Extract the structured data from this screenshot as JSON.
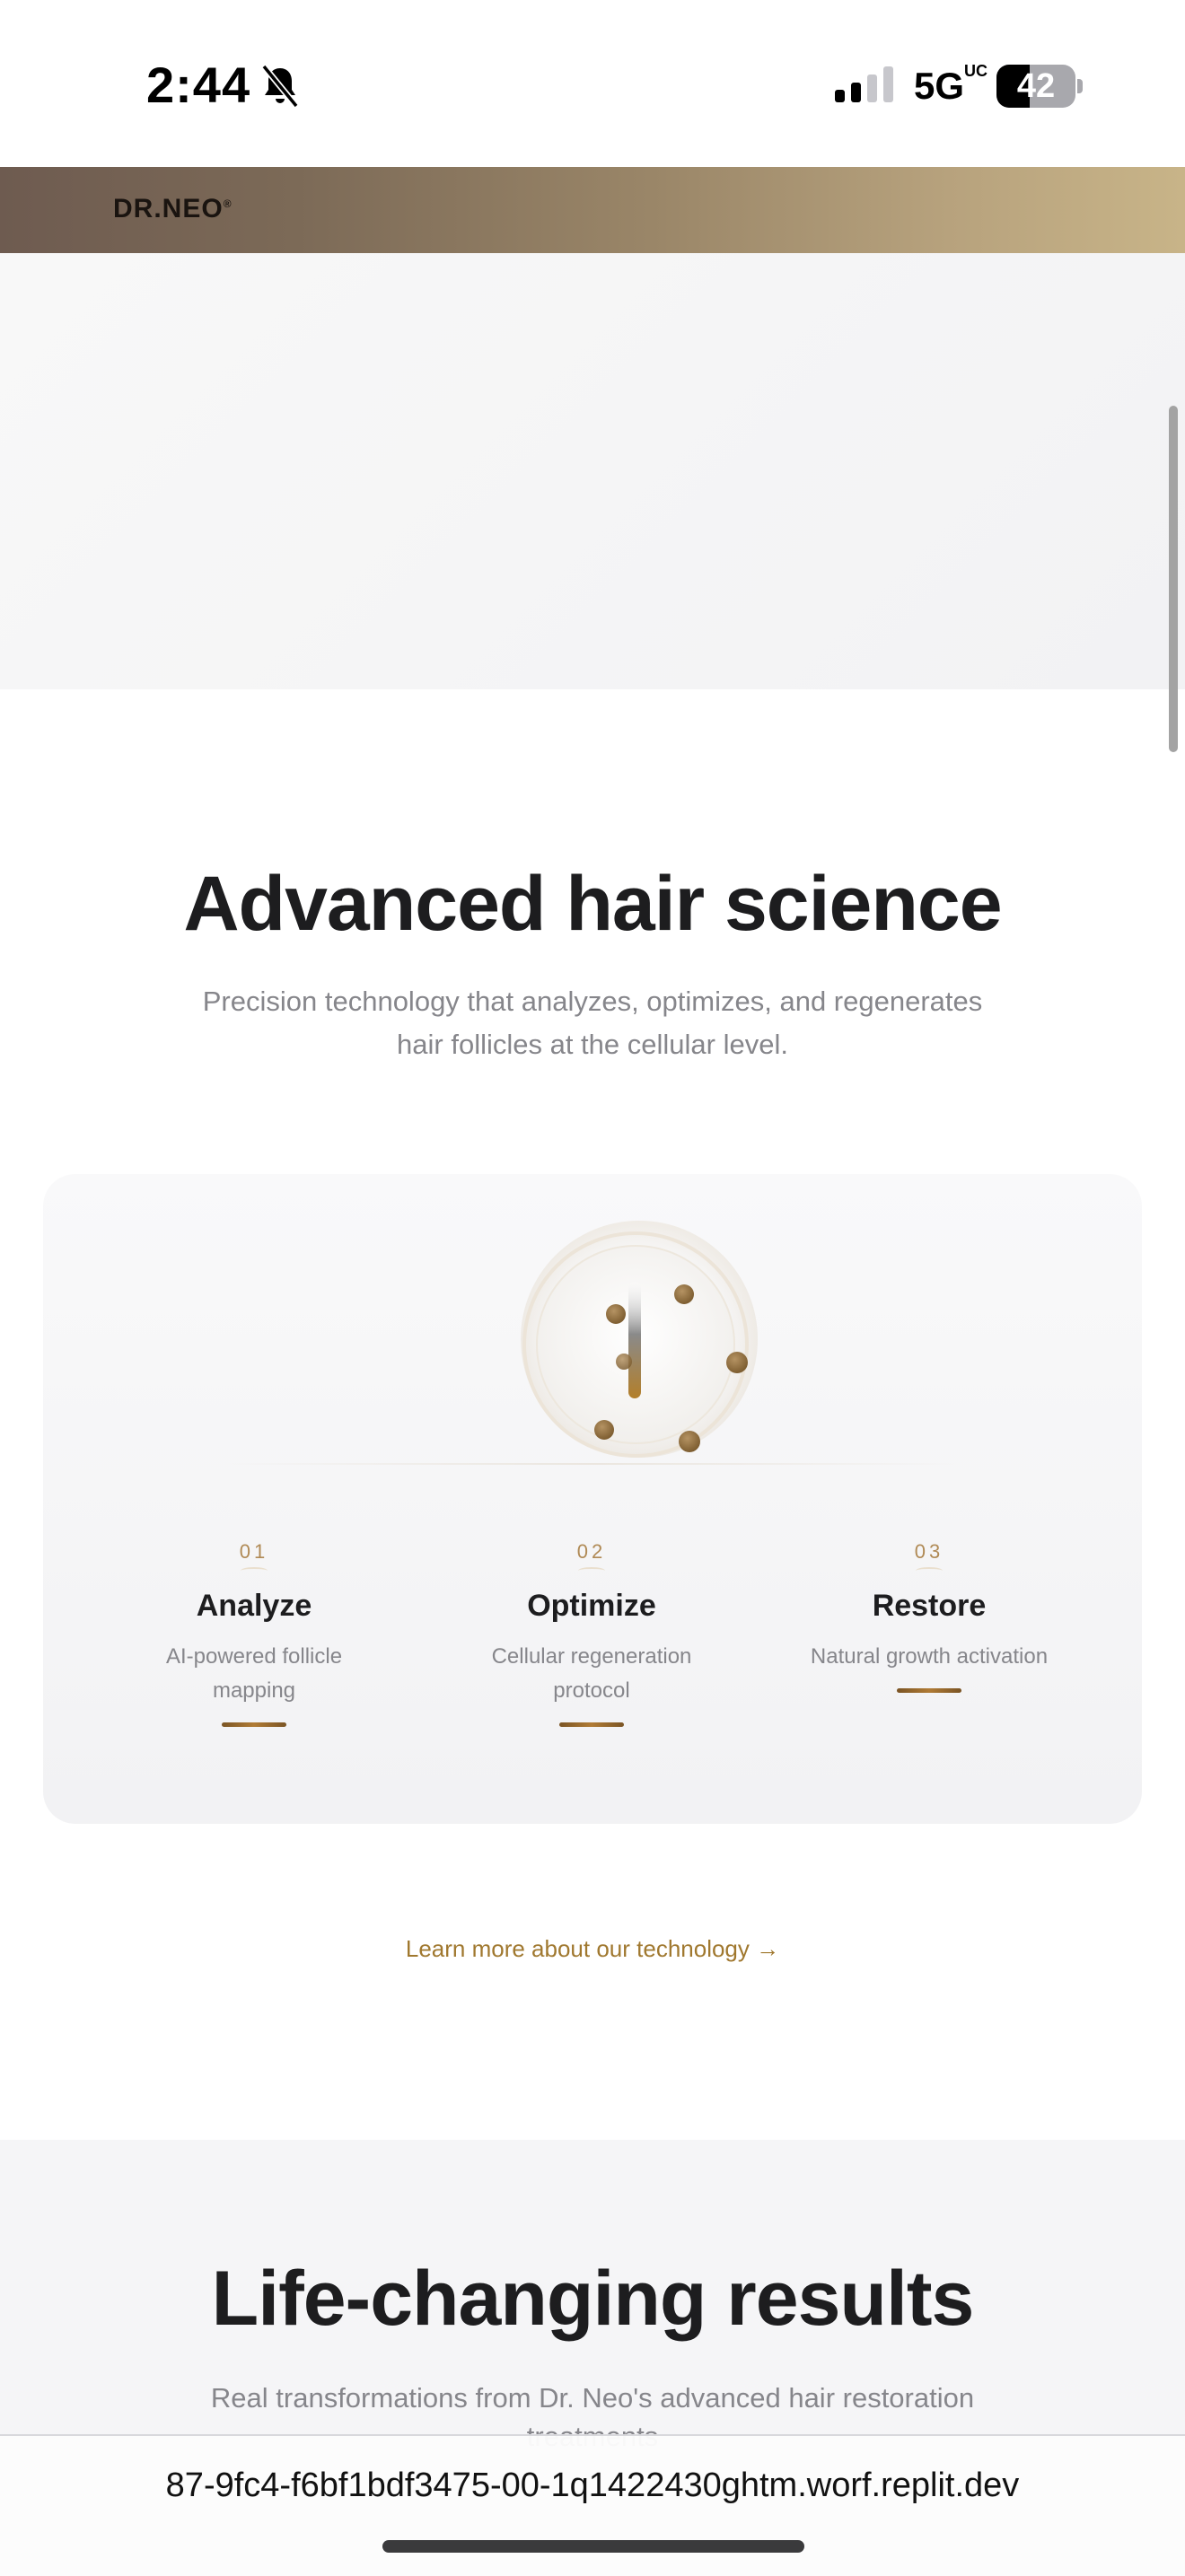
{
  "status_bar": {
    "time": "2:44",
    "network": "5G",
    "network_suffix": "UC",
    "battery": "42",
    "battery_level": 0.42,
    "icons": [
      "bell-slash-icon",
      "signal-icon",
      "battery-icon"
    ]
  },
  "brand": {
    "logo": "DR.NEO",
    "logo_mark": "®"
  },
  "science": {
    "title": "Advanced hair science",
    "subtitle": "Precision technology that analyzes, optimizes, and regenerates hair follicles at the cellular level.",
    "steps": [
      {
        "number": "01",
        "title": "Analyze",
        "description": "AI-powered follicle mapping"
      },
      {
        "number": "02",
        "title": "Optimize",
        "description": "Cellular regeneration protocol"
      },
      {
        "number": "03",
        "title": "Restore",
        "description": "Natural growth activation"
      }
    ],
    "link": "Learn more about our technology →"
  },
  "results": {
    "title": "Life-changing results",
    "subtitle": "Real transformations from Dr. Neo's advanced hair restoration treatments"
  },
  "browser": {
    "url": "87-9fc4-f6bf1bdf3475-00-1q1422430ghtm.worf.replit.dev"
  },
  "colors": {
    "accent_gold": "#a0782f",
    "brand_gradient_start": "#6e5b50",
    "brand_gradient_end": "#c8b488",
    "text_primary": "#1d1d1f",
    "text_secondary": "#86868b"
  }
}
